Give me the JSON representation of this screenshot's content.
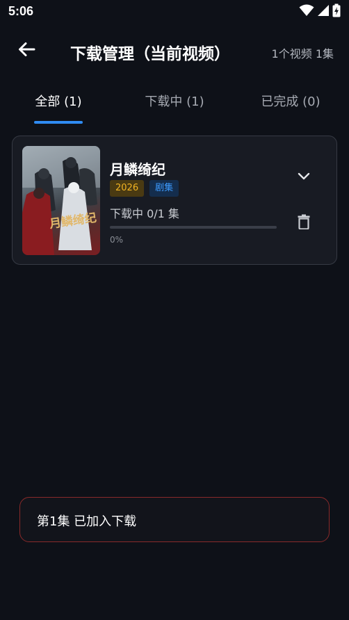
{
  "status_bar": {
    "time": "5:06",
    "icons": [
      "wifi-icon",
      "cellular-signal-icon",
      "battery-charging-icon"
    ]
  },
  "app_bar": {
    "back_icon": "arrow-left-icon",
    "title": "下载管理（当前视频）",
    "summary": "1个视频 1集"
  },
  "tabs": [
    {
      "label": "全部 (1)",
      "active": true
    },
    {
      "label": "下载中 (1)",
      "active": false
    },
    {
      "label": "已完成 (0)",
      "active": false
    }
  ],
  "downloads": [
    {
      "title": "月鳞绮纪",
      "year_badge": "2026",
      "type_badge": "剧集",
      "status": "下载中 0/1 集",
      "progress_label": "0%",
      "progress": 0,
      "expand_icon": "chevron-down-icon",
      "delete_icon": "trash-icon",
      "poster_title_calligraphy": "月鳞绮纪"
    }
  ],
  "toast": {
    "message": "第1集 已加入下载"
  },
  "colors": {
    "background": "#0e1118",
    "card": "#181b23",
    "accent": "#2f8bf2",
    "year_badge_text": "#f2b423",
    "type_badge_text": "#3d9bff",
    "toast_border": "#8a2a2a"
  }
}
